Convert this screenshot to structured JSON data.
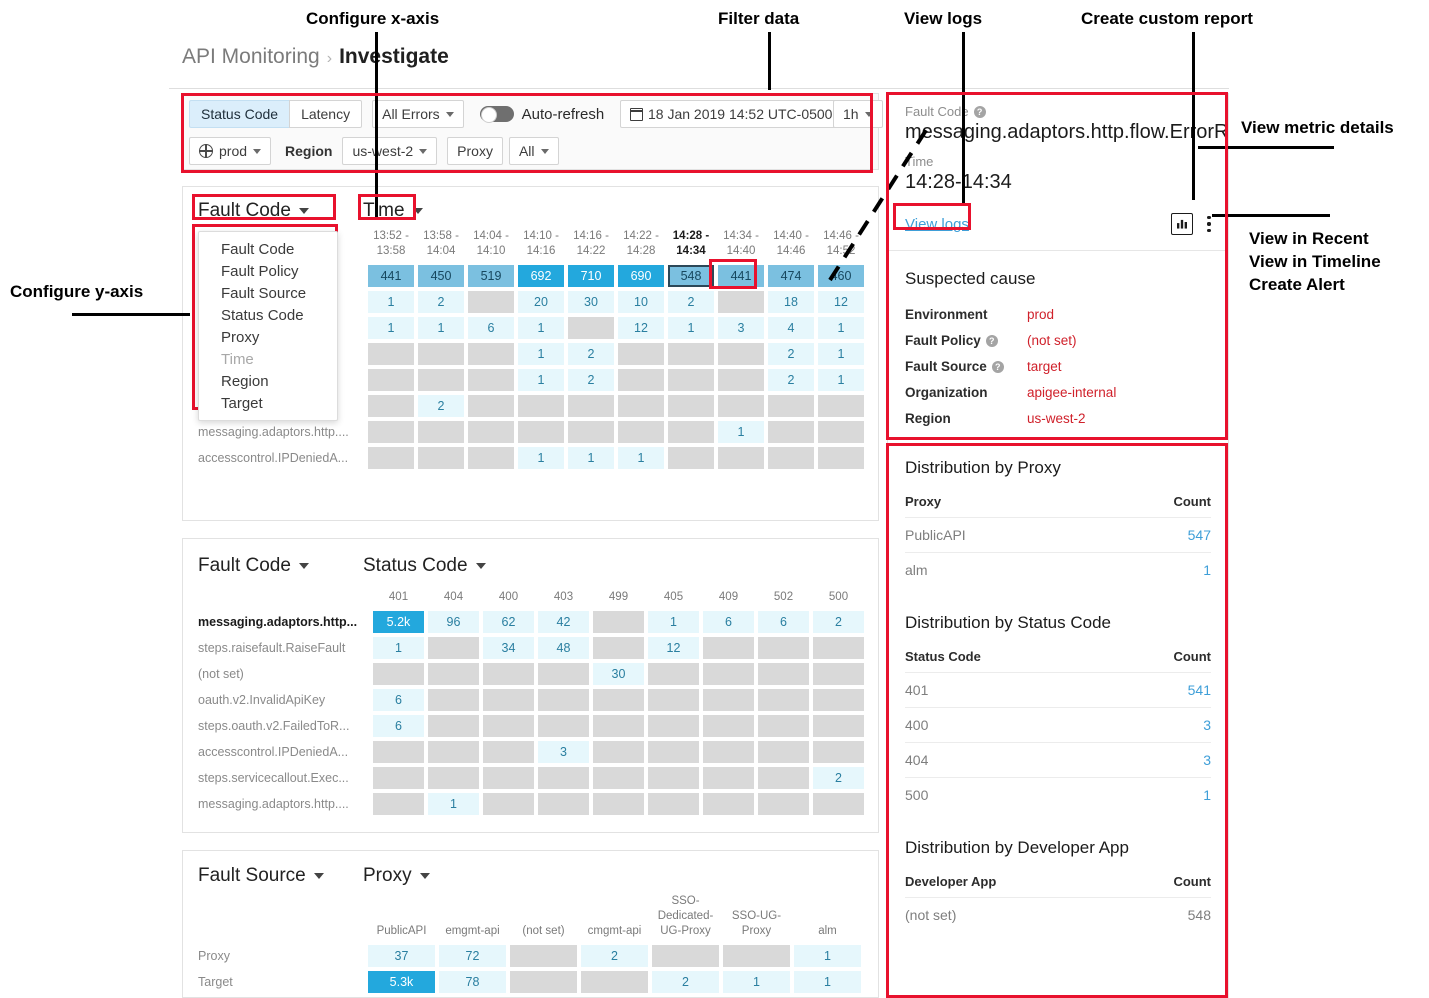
{
  "annotations": [
    {
      "id": "configure-x-axis",
      "text": "Configure x-axis"
    },
    {
      "id": "filter-data",
      "text": "Filter data"
    },
    {
      "id": "view-logs",
      "text": "View logs"
    },
    {
      "id": "create-custom-report",
      "text": "Create custom report"
    },
    {
      "id": "view-metric-details",
      "text": "View metric details"
    },
    {
      "id": "view-in-recent",
      "text": "View in Recent"
    },
    {
      "id": "view-in-timeline",
      "text": "View in Timeline"
    },
    {
      "id": "create-alert",
      "text": "Create Alert"
    },
    {
      "id": "configure-y-axis",
      "text": "Configure y-axis"
    }
  ],
  "breadcrumb": {
    "root": "API Monitoring",
    "separator": "›",
    "current": "Investigate"
  },
  "toolbar": {
    "status_code_tab": "Status Code",
    "latency_tab": "Latency",
    "errors_filter": "All Errors",
    "autorefresh_label": "Auto-refresh",
    "date_range": "18 Jan 2019 14:52 UTC-0500",
    "interval": "1h",
    "environment": "prod",
    "region_label": "Region",
    "region_value": "us-west-2",
    "proxy_label": "Proxy",
    "proxy_value": "All"
  },
  "axis_menu": {
    "items": [
      {
        "label": "Fault Code",
        "dim": false
      },
      {
        "label": "Fault Policy",
        "dim": false
      },
      {
        "label": "Fault Source",
        "dim": false
      },
      {
        "label": "Status Code",
        "dim": false
      },
      {
        "label": "Proxy",
        "dim": false
      },
      {
        "label": "Time",
        "dim": true
      },
      {
        "label": "Region",
        "dim": false
      },
      {
        "label": "Target",
        "dim": false
      }
    ]
  },
  "chart_data": [
    {
      "id": "panel1",
      "type": "heatmap",
      "title": "",
      "y_axis_label": "Fault Code",
      "x_axis_label": "Time",
      "categories": [
        "13:52 -\n13:58",
        "13:58 -\n14:04",
        "14:04 -\n14:10",
        "14:10 -\n14:16",
        "14:16 -\n14:22",
        "14:22 -\n14:28",
        "14:28 -\n14:34",
        "14:34 -\n14:40",
        "14:40 -\n14:46",
        "14:46 -\n14:52"
      ],
      "highlighted_category_index": 6,
      "selected_cell": {
        "row": 0,
        "col": 6
      },
      "rows": [
        {
          "label": "",
          "values": [
            441,
            450,
            519,
            692,
            710,
            690,
            548,
            441,
            474,
            460
          ],
          "levels": [
            "l2",
            "l2",
            "l2",
            "l3",
            "l3",
            "l3",
            "l2",
            "l2",
            "l2",
            "l2"
          ]
        },
        {
          "label": "",
          "values": [
            1,
            2,
            null,
            20,
            30,
            10,
            2,
            null,
            18,
            12
          ],
          "levels": [
            "l1",
            "l1",
            "e",
            "l1",
            "l1",
            "l1",
            "l1",
            "e",
            "l1",
            "l1"
          ]
        },
        {
          "label": "",
          "values": [
            1,
            1,
            6,
            1,
            null,
            12,
            1,
            3,
            4,
            1
          ],
          "levels": [
            "l1",
            "l1",
            "l1",
            "l1",
            "e",
            "l1",
            "l1",
            "l1",
            "l1",
            "l1"
          ]
        },
        {
          "label": "",
          "values": [
            null,
            null,
            null,
            1,
            2,
            null,
            null,
            null,
            2,
            1
          ],
          "levels": [
            "e",
            "e",
            "e",
            "l1",
            "l1",
            "e",
            "e",
            "e",
            "l1",
            "l1"
          ]
        },
        {
          "label": "",
          "values": [
            null,
            null,
            null,
            1,
            2,
            null,
            null,
            null,
            2,
            1
          ],
          "levels": [
            "e",
            "e",
            "e",
            "l1",
            "l1",
            "e",
            "e",
            "e",
            "l1",
            "l1"
          ]
        },
        {
          "label": "",
          "values": [
            null,
            2,
            null,
            null,
            null,
            null,
            null,
            null,
            null,
            null
          ],
          "levels": [
            "e",
            "l1",
            "e",
            "e",
            "e",
            "e",
            "e",
            "e",
            "e",
            "e"
          ]
        },
        {
          "label": "messaging.adaptors.http....",
          "values": [
            null,
            null,
            null,
            null,
            null,
            null,
            null,
            1,
            null,
            null
          ],
          "levels": [
            "e",
            "e",
            "e",
            "e",
            "e",
            "e",
            "e",
            "l1",
            "e",
            "e"
          ]
        },
        {
          "label": "accesscontrol.IPDeniedA...",
          "values": [
            null,
            null,
            null,
            1,
            1,
            1,
            null,
            null,
            null,
            null
          ],
          "levels": [
            "e",
            "e",
            "e",
            "l1",
            "l1",
            "l1",
            "e",
            "e",
            "e",
            "e"
          ]
        }
      ]
    },
    {
      "id": "panel2",
      "type": "heatmap",
      "y_axis_label": "Fault Code",
      "x_axis_label": "Status Code",
      "categories": [
        "401",
        "404",
        "400",
        "403",
        "499",
        "405",
        "409",
        "502",
        "500"
      ],
      "rows": [
        {
          "label": "messaging.adaptors.http...",
          "bold": true,
          "values": [
            "5.2k",
            96,
            62,
            42,
            null,
            1,
            6,
            6,
            2
          ],
          "levels": [
            "l3",
            "l1",
            "l1",
            "l1",
            "e",
            "l1",
            "l1",
            "l1",
            "l1"
          ]
        },
        {
          "label": "steps.raisefault.RaiseFault",
          "values": [
            1,
            null,
            34,
            48,
            null,
            12,
            null,
            null,
            null
          ],
          "levels": [
            "l1",
            "e",
            "l1",
            "l1",
            "e",
            "l1",
            "e",
            "e",
            "e"
          ]
        },
        {
          "label": "(not set)",
          "values": [
            null,
            null,
            null,
            null,
            30,
            null,
            null,
            null,
            null
          ],
          "levels": [
            "e",
            "e",
            "e",
            "e",
            "l1",
            "e",
            "e",
            "e",
            "e"
          ]
        },
        {
          "label": "oauth.v2.InvalidApiKey",
          "values": [
            6,
            null,
            null,
            null,
            null,
            null,
            null,
            null,
            null
          ],
          "levels": [
            "l1",
            "e",
            "e",
            "e",
            "e",
            "e",
            "e",
            "e",
            "e"
          ]
        },
        {
          "label": "steps.oauth.v2.FailedToR...",
          "values": [
            6,
            null,
            null,
            null,
            null,
            null,
            null,
            null,
            null
          ],
          "levels": [
            "l1",
            "e",
            "e",
            "e",
            "e",
            "e",
            "e",
            "e",
            "e"
          ]
        },
        {
          "label": "accesscontrol.IPDeniedA...",
          "values": [
            null,
            null,
            null,
            3,
            null,
            null,
            null,
            null,
            null
          ],
          "levels": [
            "e",
            "e",
            "e",
            "l1",
            "e",
            "e",
            "e",
            "e",
            "e"
          ]
        },
        {
          "label": "steps.servicecallout.Exec...",
          "values": [
            null,
            null,
            null,
            null,
            null,
            null,
            null,
            null,
            2
          ],
          "levels": [
            "e",
            "e",
            "e",
            "e",
            "e",
            "e",
            "e",
            "e",
            "l1"
          ]
        },
        {
          "label": "messaging.adaptors.http....",
          "values": [
            null,
            1,
            null,
            null,
            null,
            null,
            null,
            null,
            null
          ],
          "levels": [
            "e",
            "l1",
            "e",
            "e",
            "e",
            "e",
            "e",
            "e",
            "e"
          ]
        }
      ]
    },
    {
      "id": "panel3",
      "type": "heatmap",
      "y_axis_label": "Fault Source",
      "x_axis_label": "Proxy",
      "categories": [
        "PublicAPI",
        "emgmt-api",
        "(not set)",
        "cmgmt-api",
        "SSO-\nDedicated-\nUG-Proxy",
        "SSO-UG-\nProxy",
        "alm"
      ],
      "rows": [
        {
          "label": "Proxy",
          "values": [
            37,
            72,
            null,
            2,
            null,
            null,
            1
          ],
          "levels": [
            "l1",
            "l1",
            "e",
            "l1",
            "e",
            "e",
            "l1"
          ]
        },
        {
          "label": "Target",
          "values": [
            "5.3k",
            78,
            null,
            null,
            2,
            1,
            1
          ],
          "levels": [
            "l3",
            "l1",
            "e",
            "e",
            "l1",
            "l1",
            "l1"
          ]
        }
      ]
    }
  ],
  "detail": {
    "fault_code_label": "Fault Code",
    "fault_code_value": "messaging.adaptors.http.flow.ErrorRe...",
    "time_label": "Time",
    "time_value": "14:28-14:34",
    "view_logs_link": "View logs",
    "suspected_cause_title": "Suspected cause",
    "suspected_cause": [
      {
        "key": "Environment",
        "value": "prod",
        "help": false
      },
      {
        "key": "Fault Policy",
        "value": "(not set)",
        "help": true
      },
      {
        "key": "Fault Source",
        "value": "target",
        "help": true
      },
      {
        "key": "Organization",
        "value": "apigee-internal",
        "help": false
      },
      {
        "key": "Region",
        "value": "us-west-2",
        "help": false
      }
    ],
    "distributions": [
      {
        "title": "Distribution by Proxy",
        "columns": [
          "Proxy",
          "Count"
        ],
        "rows": [
          {
            "name": "PublicAPI",
            "count": "547",
            "grey": false
          },
          {
            "name": "alm",
            "count": "1",
            "grey": false
          }
        ]
      },
      {
        "title": "Distribution by Status Code",
        "columns": [
          "Status Code",
          "Count"
        ],
        "rows": [
          {
            "name": "401",
            "count": "541",
            "grey": false
          },
          {
            "name": "400",
            "count": "3",
            "grey": false
          },
          {
            "name": "404",
            "count": "3",
            "grey": false
          },
          {
            "name": "500",
            "count": "1",
            "grey": false
          }
        ]
      },
      {
        "title": "Distribution by Developer App",
        "columns": [
          "Developer App",
          "Count"
        ],
        "rows": [
          {
            "name": "(not set)",
            "count": "548",
            "grey": true
          }
        ]
      }
    ]
  },
  "colors": {
    "annotation_red": "#e8112d",
    "link_blue": "#3f9fd8",
    "value_red": "#d0212b",
    "heat_high": "#23a8dd",
    "heat_mid": "#7bc0e0",
    "heat_low": "#e6f7fc",
    "heat_empty": "#d9d9d9"
  }
}
